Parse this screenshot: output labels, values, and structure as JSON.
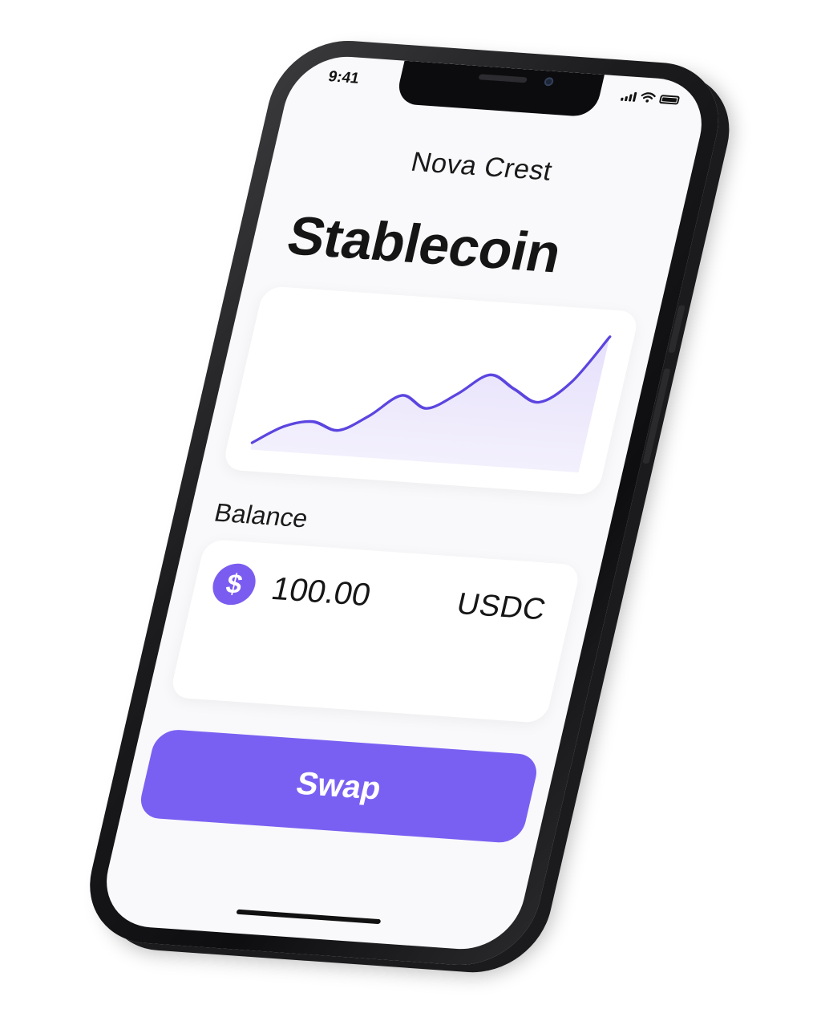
{
  "status_bar": {
    "time": "9:41",
    "icons": [
      "cellular-signal-icon",
      "wifi-icon",
      "battery-icon"
    ]
  },
  "app": {
    "brand": "Nova Crest",
    "title": "Stablecoin"
  },
  "chart": {
    "line_color": "#5b45e0",
    "fill_color": "#e6e0fb"
  },
  "chart_data": {
    "type": "area",
    "title": "",
    "xlabel": "",
    "ylabel": "",
    "grid": false,
    "legend": "none",
    "x": [
      0,
      1,
      2,
      3,
      4,
      5,
      6,
      7,
      8,
      9,
      10,
      11,
      12
    ],
    "values": [
      0.5,
      1.8,
      2.3,
      1.8,
      3.0,
      4.6,
      3.8,
      5.0,
      6.5,
      5.6,
      4.8,
      6.4,
      9.8
    ],
    "ylim": [
      0,
      10
    ]
  },
  "balance": {
    "label": "Balance",
    "coin_symbol": "$",
    "amount": "100.00",
    "currency": "USDC",
    "coin_color": "#7b5cf0"
  },
  "actions": {
    "swap_label": "Swap",
    "accent": "#7a60f2"
  }
}
